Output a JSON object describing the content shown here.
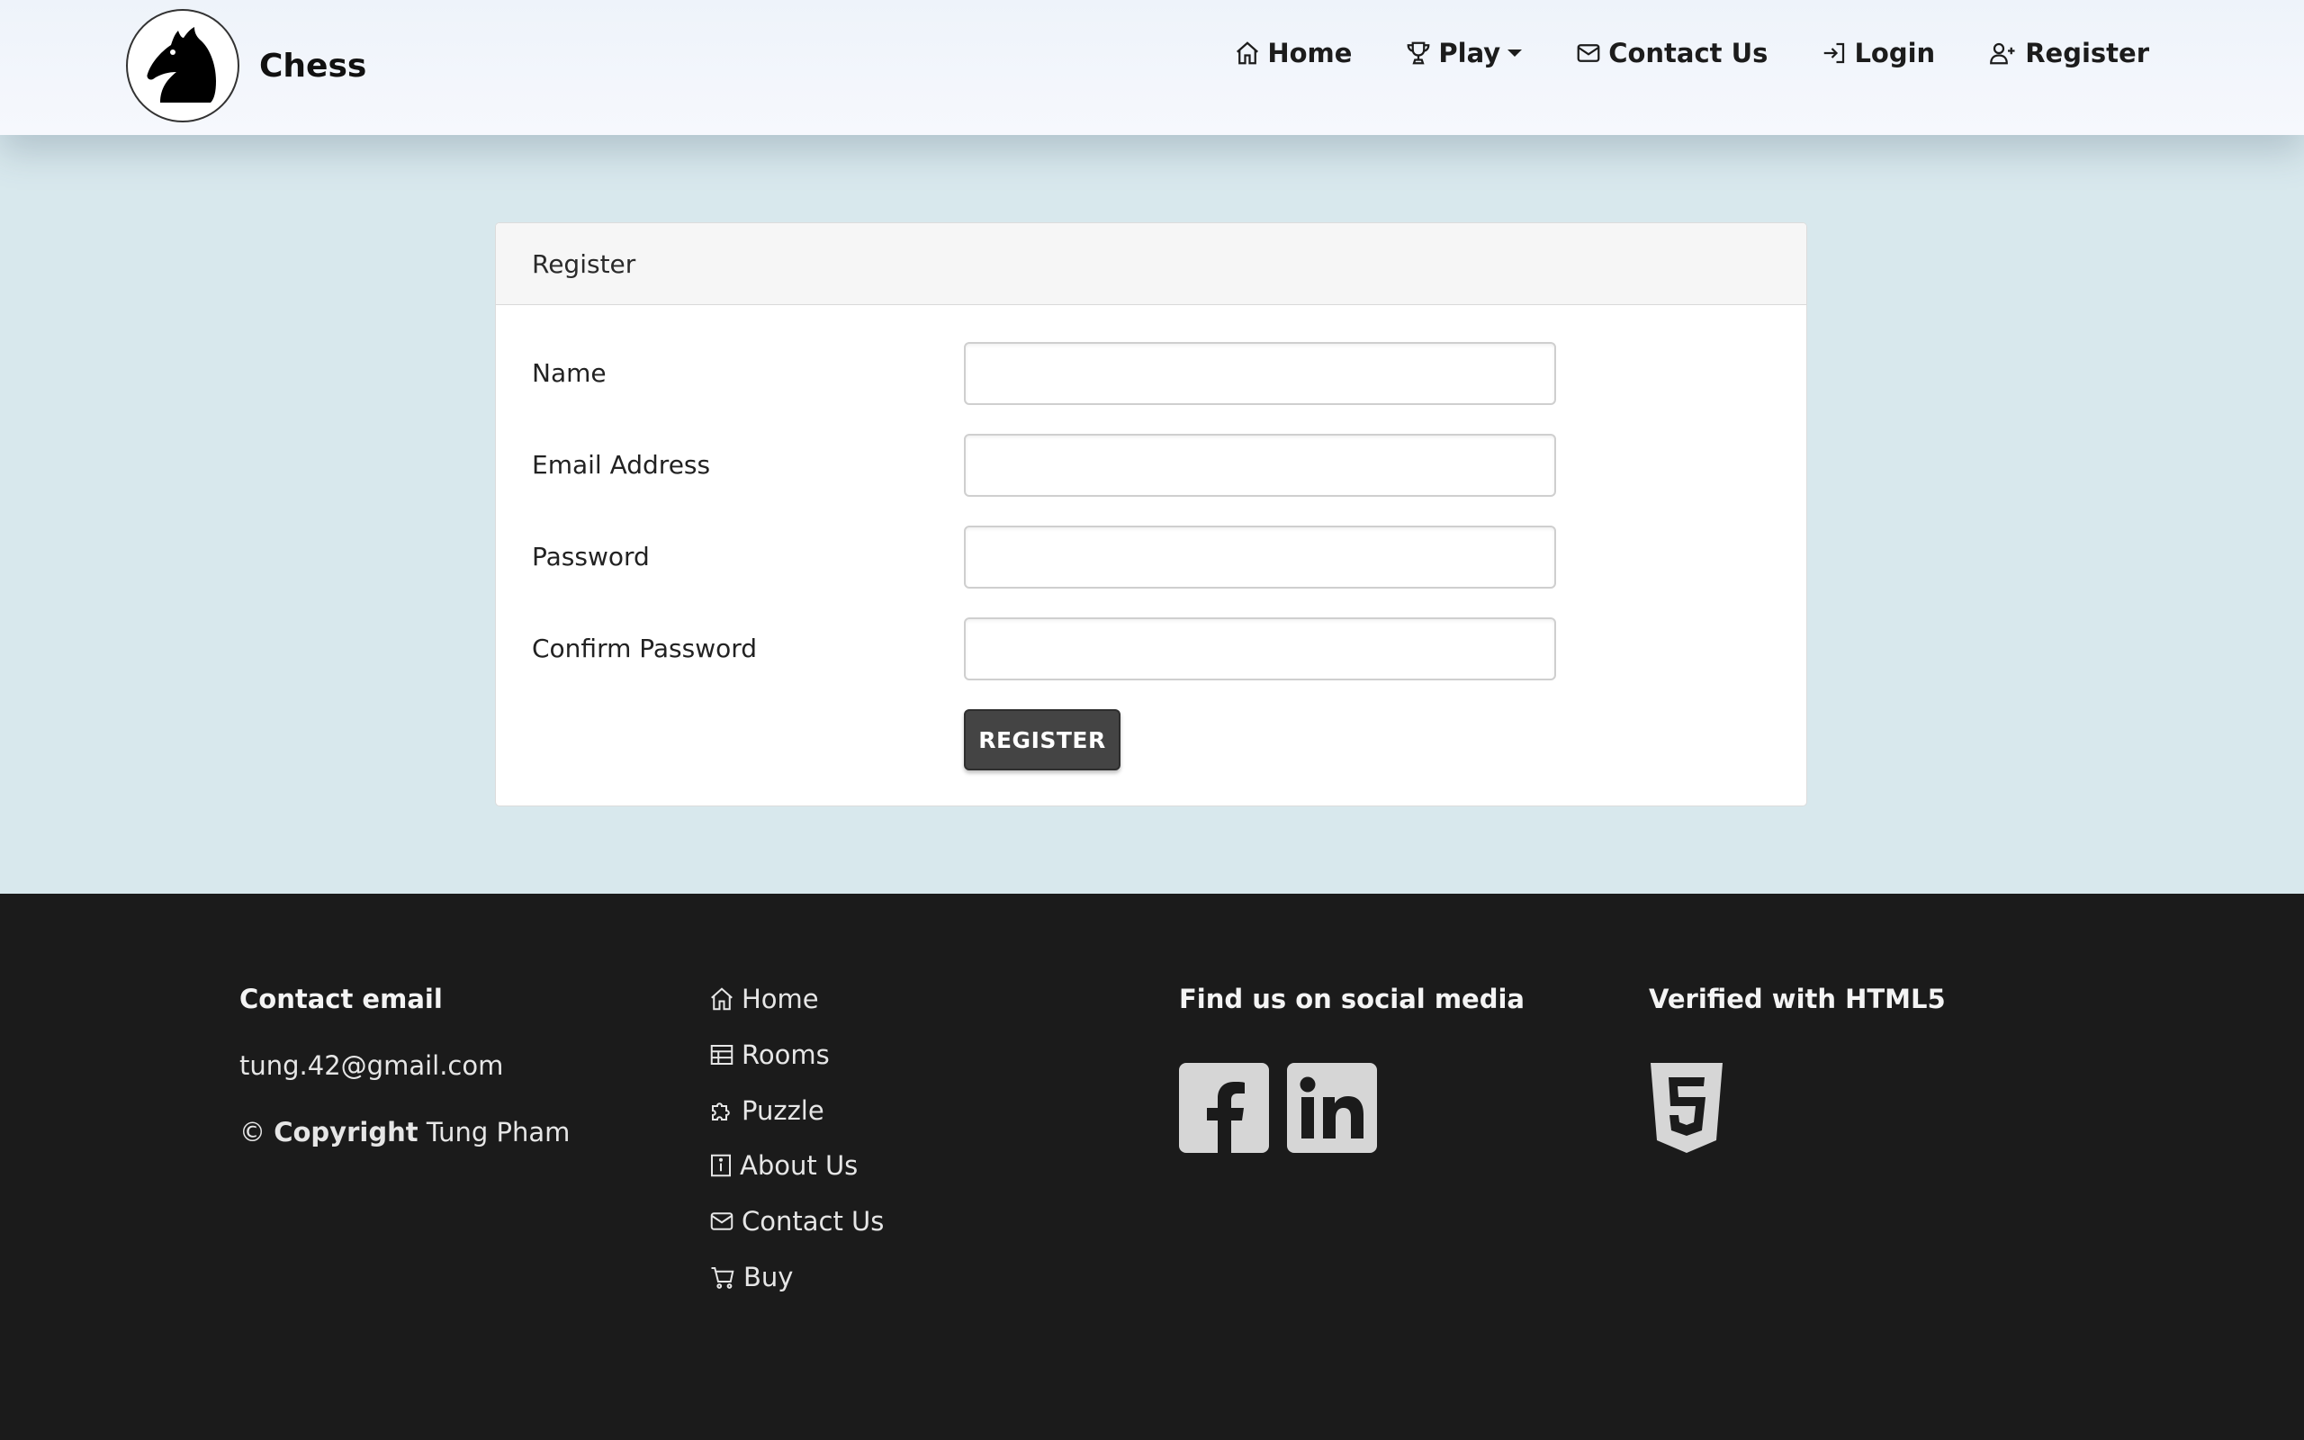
{
  "navbar": {
    "brand": "Chess",
    "links": [
      {
        "label": "Home",
        "icon": "house-icon"
      },
      {
        "label": "Play",
        "icon": "trophy-icon"
      },
      {
        "label": "Contact Us",
        "icon": "envelope-icon"
      },
      {
        "label": "Login",
        "icon": "login-icon"
      },
      {
        "label": "Register",
        "icon": "user-plus-icon"
      }
    ]
  },
  "register_card": {
    "header": "Register",
    "fields": [
      {
        "label": "Name",
        "value": "",
        "type": "text"
      },
      {
        "label": "Email Address",
        "value": "",
        "type": "email"
      },
      {
        "label": "Password",
        "value": "",
        "type": "password"
      },
      {
        "label": "Confirm Password",
        "value": "",
        "type": "password"
      }
    ],
    "submit_label": "REGISTER"
  },
  "footer": {
    "contact": {
      "heading": "Contact email",
      "email": "tung.42@gmail.com",
      "copyright_symbol": "©",
      "copyright_label": "Copyright",
      "copyright_name": "Tung Pham"
    },
    "links": [
      {
        "label": "Home",
        "icon": "house-icon"
      },
      {
        "label": "Rooms",
        "icon": "table-icon"
      },
      {
        "label": "Puzzle",
        "icon": "puzzle-icon"
      },
      {
        "label": "About Us",
        "icon": "info-icon"
      },
      {
        "label": "Contact Us",
        "icon": "envelope-icon"
      },
      {
        "label": "Buy",
        "icon": "cart-icon"
      }
    ],
    "social": {
      "heading": "Find us on social media",
      "icons": [
        "facebook-icon",
        "linkedin-icon"
      ]
    },
    "verified": {
      "heading": "Verified with HTML5",
      "icon": "html5-icon"
    }
  },
  "colors": {
    "page_bg": "#d8e8ed",
    "navbar_bg": "#eef3fa",
    "footer_bg": "#1b1b1b",
    "button_bg": "#444444",
    "icon_gray": "#d6d6d6"
  }
}
